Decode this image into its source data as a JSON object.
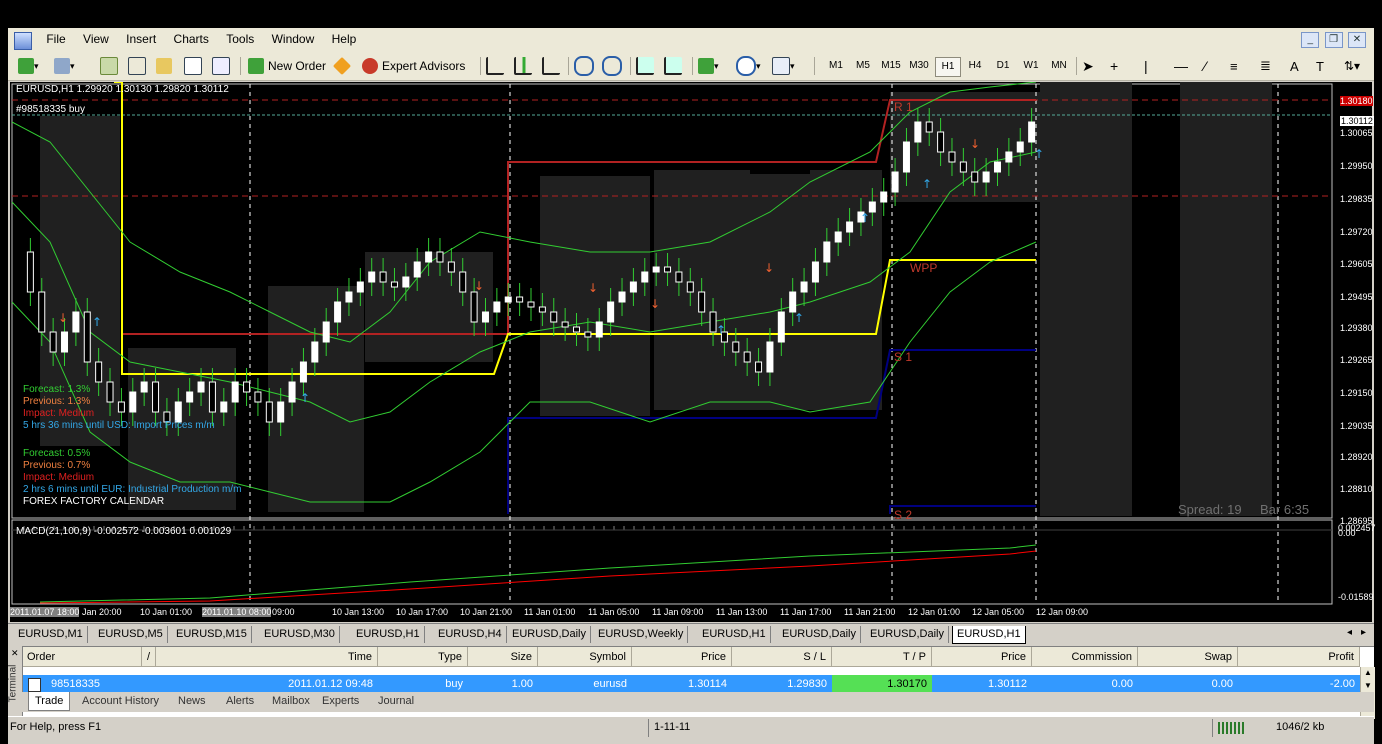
{
  "menubar": {
    "items": [
      "File",
      "View",
      "Insert",
      "Charts",
      "Tools",
      "Window",
      "Help"
    ]
  },
  "toolbar": {
    "new_order_label": "New Order",
    "expert_advisors_label": "Expert Advisors",
    "timeframes": [
      "M1",
      "M5",
      "M15",
      "M30",
      "H1",
      "H4",
      "D1",
      "W1",
      "MN"
    ],
    "active_timeframe": "H1"
  },
  "chart": {
    "header": "EURUSD,H1  1.29920 1.30130 1.29820 1.30112",
    "order_line_label": "#98518335 buy",
    "pivots": {
      "r1": "R 1",
      "wpp": "WPP",
      "s1": "S 1",
      "s2": "S 2"
    },
    "news1": {
      "forecast": "Forecast: 1.3%",
      "previous": "Previous: 1.3%",
      "impact": "Impact: Medium",
      "countdown": "5 hrs 36 mins until USD: Import Prices m/m"
    },
    "news2": {
      "forecast": "Forecast: 0.5%",
      "previous": "Previous: 0.7%",
      "impact": "Impact: Medium",
      "countdown": "2 hrs 6 mins until EUR: Industrial Production m/m",
      "source": "FOREX FACTORY CALENDAR"
    },
    "spread": "Spread: 19",
    "bar_timer": "Bar  6:35",
    "price_axis": [
      "1.30180",
      "1.30112",
      "1.30065",
      "1.29950",
      "1.29835",
      "1.29720",
      "1.29605",
      "1.29495",
      "1.29380",
      "1.29265",
      "1.29150",
      "1.29035",
      "1.28920",
      "1.28810",
      "1.28695"
    ],
    "macd_label": "MACD(21,100,9) -0.002572 -0.003601 0.001029",
    "macd_axis": [
      "0.002457",
      "0.00",
      "-0.01589"
    ],
    "time_axis": [
      "2011.01.07 18:00",
      "Jan 20:00",
      "10 Jan 01:00",
      "2011.01.10 08:00",
      "09:00",
      "10 Jan 13:00",
      "10 Jan 17:00",
      "10 Jan 21:00",
      "11 Jan 01:00",
      "11 Jan 05:00",
      "11 Jan 09:00",
      "11 Jan 13:00",
      "11 Jan 17:00",
      "11 Jan 21:00",
      "12 Jan 01:00",
      "12 Jan 05:00",
      "12 Jan 09:00"
    ],
    "colors": {
      "bull": "#ffffff",
      "bear": "#ffffff",
      "wick": "#32cd32",
      "band": "#32cd32",
      "pivot_wpp": "#ffff00",
      "pivot_r": "#b22222",
      "pivot_s": "#000080",
      "macd_main": "#32cd32",
      "macd_signal": "#ff0000"
    }
  },
  "chart_tabs": [
    "EURUSD,M1",
    "EURUSD,M5",
    "EURUSD,M15",
    "EURUSD,M30",
    "EURUSD,H1",
    "EURUSD,H4",
    "EURUSD,Daily",
    "EURUSD,Weekly",
    "EURUSD,H1",
    "EURUSD,Daily",
    "EURUSD,Daily",
    "EURUSD,H1"
  ],
  "active_chart_tab": "EURUSD,H1",
  "terminal": {
    "side_label": "Terminal",
    "columns": [
      "Order",
      "/",
      "Time",
      "Type",
      "Size",
      "Symbol",
      "Price",
      "S / L",
      "T / P",
      "Price",
      "Commission",
      "Swap",
      "Profit"
    ],
    "row": {
      "order": "98518335",
      "time": "2011.01.12 09:48",
      "type": "buy",
      "size": "1.00",
      "symbol": "eurusd",
      "price": "1.30114",
      "sl": "1.29830",
      "tp": "1.30170",
      "current": "1.30112",
      "commission": "0.00",
      "swap": "0.00",
      "profit": "-2.00"
    },
    "tabs": [
      "Trade",
      "Account History",
      "News",
      "Alerts",
      "Mailbox",
      "Experts",
      "Journal"
    ],
    "active_tab": "Trade"
  },
  "status": {
    "help": "For Help, press F1",
    "profile": "1-11-11",
    "traffic": "1046/2 kb"
  }
}
